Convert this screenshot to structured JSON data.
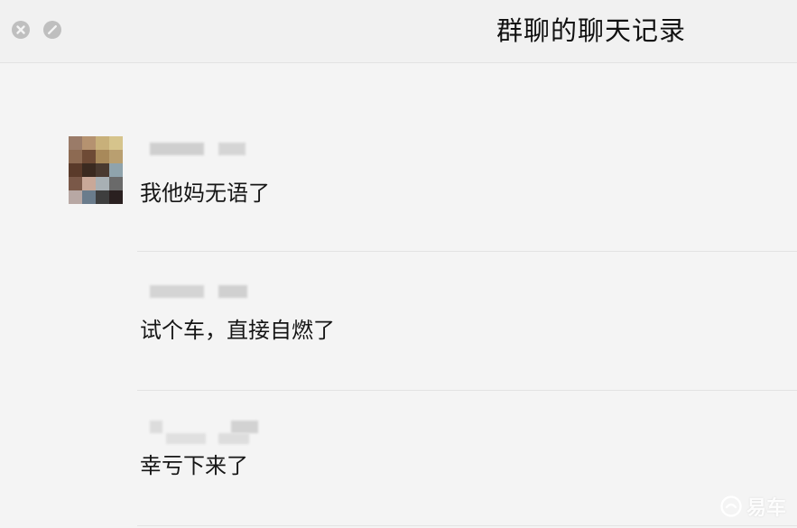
{
  "window": {
    "title": "群聊的聊天记录",
    "close_icon": "close-icon",
    "minimize_icon": "minimize-icon"
  },
  "messages": [
    {
      "text": "我他妈无语了",
      "avatar": "pixelated-avatar",
      "sender": "blurred"
    },
    {
      "text": "试个车，直接自燃了",
      "sender": "blurred"
    },
    {
      "text": "幸亏下来了",
      "sender": "blurred"
    }
  ],
  "watermark": {
    "text": "易车",
    "icon": "yiche-logo-icon"
  },
  "colors": {
    "background": "#f4f4f4",
    "titlebar": "#f1f1f1",
    "text": "#161616",
    "button": "#bfbfbf"
  }
}
